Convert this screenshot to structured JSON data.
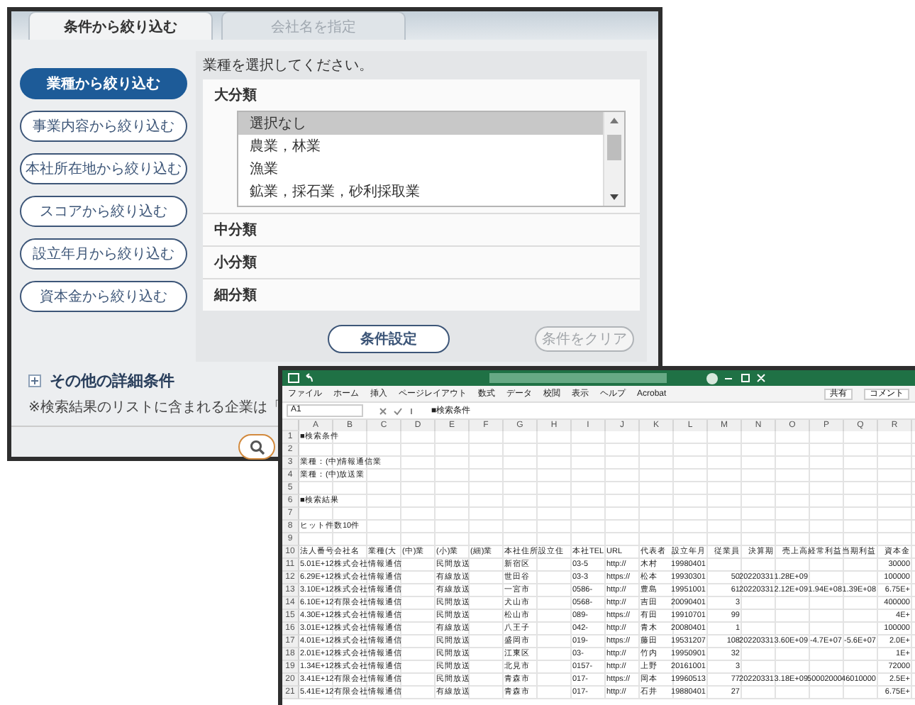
{
  "search_window": {
    "tabs": [
      {
        "label": "条件から絞り込む",
        "selected": true
      },
      {
        "label": "会社名を指定",
        "selected": false
      }
    ],
    "filter_buttons": [
      {
        "label": "業種から絞り込む",
        "selected": true
      },
      {
        "label": "事業内容から絞り込む",
        "selected": false
      },
      {
        "label": "本社所在地から絞り込む",
        "selected": false
      },
      {
        "label": "スコアから絞り込む",
        "selected": false
      },
      {
        "label": "設立年月から絞り込む",
        "selected": false
      },
      {
        "label": "資本金から絞り込む",
        "selected": false
      }
    ],
    "instruction": "業種を選択してください。",
    "categories": [
      {
        "label": "大分類",
        "options": [
          {
            "label": "選択なし",
            "selected": true
          },
          {
            "label": "農業，林業",
            "selected": false
          },
          {
            "label": "漁業",
            "selected": false
          },
          {
            "label": "鉱業，採石業，砂利採取業",
            "selected": false
          }
        ]
      },
      {
        "label": "中分類"
      },
      {
        "label": "小分類"
      },
      {
        "label": "細分類"
      }
    ],
    "apply_button": {
      "label": "条件設定",
      "disabled": false
    },
    "clear_button": {
      "label": "条件をクリア",
      "disabled": true
    },
    "more_conditions": {
      "label": "その他の詳細条件",
      "expanded": false
    },
    "note": "※検索結果のリストに含まれる企業は「"
  },
  "spreadsheet": {
    "ribbon_tabs": [
      "ファイル",
      "ホーム",
      "挿入",
      "ページレイアウト",
      "数式",
      "データ",
      "校閲",
      "表示",
      "ヘルプ",
      "Acrobat"
    ],
    "share_button": "共有",
    "comment_button": "コメント",
    "name_box": "A1",
    "formula": "■検索条件",
    "columns": [
      "A",
      "B",
      "C",
      "D",
      "E",
      "F",
      "G",
      "H",
      "I",
      "J",
      "K",
      "L",
      "M",
      "N",
      "O",
      "P",
      "Q",
      "R"
    ],
    "rows": [
      {
        "number": "1",
        "cells": {
          "A": "■検索条件"
        }
      },
      {
        "number": "2",
        "cells": {}
      },
      {
        "number": "3",
        "cells": {
          "A": "業種：(中)情報通信業"
        }
      },
      {
        "number": "4",
        "cells": {
          "A": "業種：(中)放送業"
        }
      },
      {
        "number": "5",
        "cells": {}
      },
      {
        "number": "6",
        "cells": {
          "A": "■検索結果"
        }
      },
      {
        "number": "7",
        "cells": {}
      },
      {
        "number": "8",
        "cells": {
          "A": "ヒット件数10件"
        }
      },
      {
        "number": "9",
        "cells": {}
      },
      {
        "number": "10",
        "cells": {
          "A": "法人番号",
          "B": "会社名",
          "C": "業種(大",
          "D": "(中)業",
          "E": "(小)業",
          "F": "(細)業",
          "G": "本社住所",
          "H": "設立住",
          "I": "本社TEL",
          "J": "URL",
          "K": "代表者",
          "L": "設立年月",
          "M": "従業員",
          "N": "決算期",
          "O": "売上高",
          "P": "経常利益",
          "Q": "当期利益",
          "R": "資本金"
        }
      },
      {
        "number": "11",
        "cells": {
          "A": "5.01E+12",
          "B": "株式会社",
          "C": "情報通信",
          "E": "民間放送",
          "G": "新宿区",
          "I": "03-5",
          "J": "http://",
          "K": "木村",
          "L": "19980401",
          "R": "30000"
        }
      },
      {
        "number": "12",
        "cells": {
          "A": "6.29E+12",
          "B": "株式会社",
          "C": "情報通信",
          "E": "有線放送",
          "G": "世田谷",
          "I": "03-3",
          "J": "https://",
          "K": "松本",
          "L": "19930301",
          "M": "50",
          "N": "20220331",
          "O": "1.28E+09",
          "R": "100000"
        }
      },
      {
        "number": "13",
        "cells": {
          "A": "3.10E+12",
          "B": "株式会社",
          "C": "情報通信",
          "E": "有線放送",
          "G": "一宮市",
          "I": "0586-",
          "J": "http://",
          "K": "豊島",
          "L": "19951001",
          "M": "61",
          "N": "20220331",
          "O": "2.12E+09",
          "P": "1.94E+08",
          "Q": "1.39E+08",
          "R": "6.75E+"
        }
      },
      {
        "number": "14",
        "cells": {
          "A": "6.10E+12",
          "B": "有限会社",
          "C": "情報通信",
          "E": "民間放送",
          "G": "犬山市",
          "I": "0568-",
          "J": "http://",
          "K": "吉田",
          "L": "20090401",
          "M": "3",
          "R": "400000"
        }
      },
      {
        "number": "15",
        "cells": {
          "A": "4.30E+12",
          "B": "株式会社",
          "C": "情報通信",
          "E": "民間放送",
          "G": "松山市",
          "I": "089-",
          "J": "https://",
          "K": "有田",
          "L": "19910701",
          "M": "99",
          "R": "4E+"
        }
      },
      {
        "number": "16",
        "cells": {
          "A": "3.01E+12",
          "B": "株式会社",
          "C": "情報通信",
          "E": "有線放送",
          "G": "八王子",
          "I": "042-",
          "J": "http://",
          "K": "青木",
          "L": "20080401",
          "M": "1",
          "R": "100000"
        }
      },
      {
        "number": "17",
        "cells": {
          "A": "4.01E+12",
          "B": "株式会社",
          "C": "情報通信",
          "E": "民間放送",
          "G": "盛岡市",
          "I": "019-",
          "J": "https://",
          "K": "藤田",
          "L": "19531207",
          "M": "108",
          "N": "20220331",
          "O": "3.60E+09",
          "P": "-4.7E+07",
          "Q": "-5.6E+07",
          "R": "2.0E+"
        }
      },
      {
        "number": "18",
        "cells": {
          "A": "2.01E+12",
          "B": "株式会社",
          "C": "情報通信",
          "E": "民間放送",
          "G": "江東区",
          "I": "03-",
          "J": "http://",
          "K": "竹内",
          "L": "19950901",
          "M": "32",
          "R": "1E+"
        }
      },
      {
        "number": "19",
        "cells": {
          "A": "1.34E+12",
          "B": "株式会社",
          "C": "情報通信",
          "E": "民間放送",
          "G": "北見市",
          "I": "0157-",
          "J": "http://",
          "K": "上野",
          "L": "20161001",
          "M": "3",
          "R": "72000"
        }
      },
      {
        "number": "20",
        "cells": {
          "A": "3.41E+12",
          "B": "有限会社",
          "C": "情報通信",
          "E": "民間放送",
          "G": "青森市",
          "I": "017-",
          "J": "https://",
          "K": "岡本",
          "L": "19960513",
          "M": "77",
          "N": "20220331",
          "O": "3.18E+09",
          "P": "50002000",
          "Q": "46010000",
          "R": "2.5E+"
        }
      },
      {
        "number": "21",
        "cells": {
          "A": "5.41E+12",
          "B": "有限会社",
          "C": "情報通信",
          "E": "有線放送",
          "G": "青森市",
          "I": "017-",
          "J": "http://",
          "K": "石井",
          "L": "19880401",
          "M": "27",
          "R": "6.75E+"
        }
      }
    ]
  }
}
